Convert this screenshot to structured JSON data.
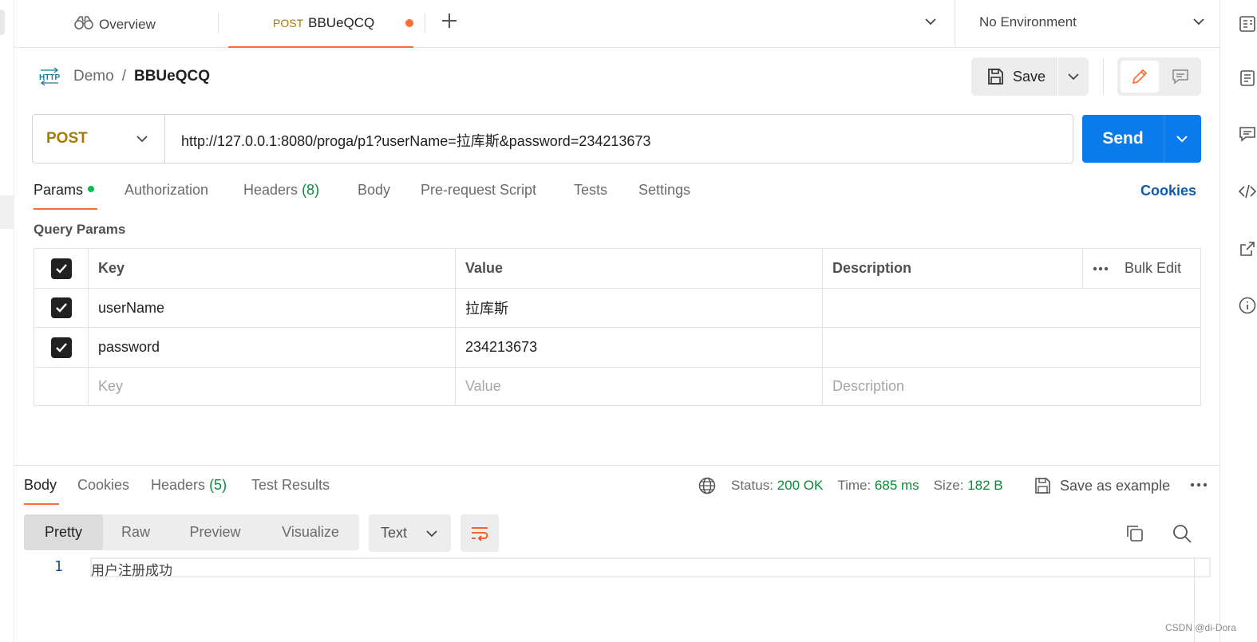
{
  "tabs": {
    "overview_label": "Overview",
    "active_method": "POST",
    "active_name": "BBUeQCQ"
  },
  "environment": {
    "label": "No Environment"
  },
  "breadcrumb": {
    "collection": "Demo",
    "separator": "/",
    "request": "BBUeQCQ"
  },
  "toolbar": {
    "save_label": "Save"
  },
  "request": {
    "method": "POST",
    "url": "http://127.0.0.1:8080/proga/p1?userName=拉库斯&password=234213673",
    "send_label": "Send"
  },
  "request_tabs": {
    "params": "Params",
    "authorization": "Authorization",
    "headers": "Headers",
    "headers_count": "(8)",
    "body": "Body",
    "prerequest": "Pre-request Script",
    "tests": "Tests",
    "settings": "Settings",
    "cookies": "Cookies"
  },
  "query_params": {
    "title": "Query Params",
    "columns": {
      "key": "Key",
      "value": "Value",
      "description": "Description",
      "bulk_edit": "Bulk Edit"
    },
    "rows": [
      {
        "checked": true,
        "key": "userName",
        "value": "拉库斯",
        "description": ""
      },
      {
        "checked": true,
        "key": "password",
        "value": "234213673",
        "description": ""
      }
    ],
    "placeholders": {
      "key": "Key",
      "value": "Value",
      "description": "Description"
    }
  },
  "response": {
    "tabs": {
      "body": "Body",
      "cookies": "Cookies",
      "headers": "Headers",
      "headers_count": "(5)",
      "test_results": "Test Results"
    },
    "status_label": "Status:",
    "status_value": "200 OK",
    "time_label": "Time:",
    "time_value": "685 ms",
    "size_label": "Size:",
    "size_value": "182 B",
    "save_example": "Save as example",
    "views": [
      "Pretty",
      "Raw",
      "Preview",
      "Visualize"
    ],
    "format": "Text",
    "lines": [
      {
        "num": "1",
        "text": "用户注册成功"
      }
    ]
  },
  "watermark": "CSDN @di-Dora",
  "colors": {
    "accent": "#ff6c37",
    "send": "#097bed",
    "status_ok": "#0c8a38",
    "method_post": "#a97a00"
  }
}
